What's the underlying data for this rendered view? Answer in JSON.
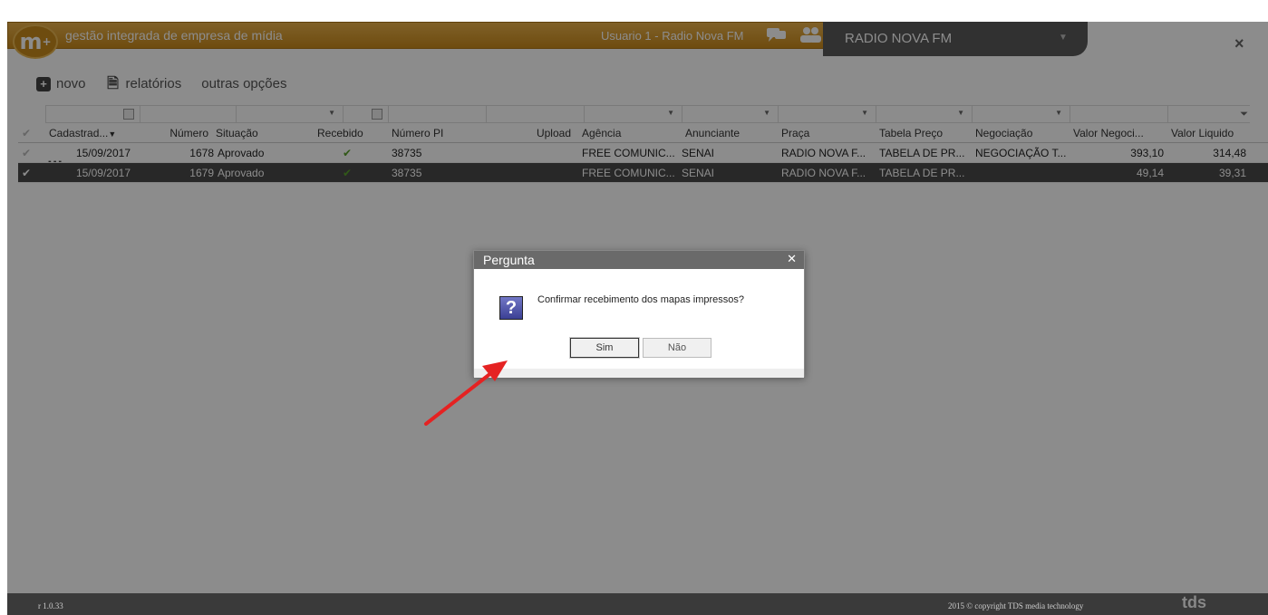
{
  "titlebar": {
    "app_title": "gestão integrada de empresa de mídia",
    "user_label": "Usuario 1 - Radio Nova FM",
    "station": "RADIO NOVA FM",
    "logo_text": "m",
    "logo_sub": "+"
  },
  "toolbar": {
    "novo": "novo",
    "relatorios": "relatórios",
    "outras": "outras opções"
  },
  "columns": [
    "Cadastrad...",
    "Número",
    "Situação",
    "Recebido",
    "Número PI",
    "Upload",
    "Agência",
    "Anunciante",
    "Praça",
    "Tabela Preço",
    "Negociação",
    "Valor Negoci...",
    "Valor Liquido"
  ],
  "rows": [
    {
      "cadastro": "15/09/2017",
      "numero": "1678",
      "situacao": "Aprovado",
      "recebido": "✔",
      "numero_pi": "38735",
      "upload": "",
      "agencia": "FREE COMUNIC...",
      "anunciante": "SENAI",
      "praca": "RADIO NOVA F...",
      "tabela": "TABELA DE PR...",
      "negociacao": "NEGOCIAÇÃO T...",
      "valor_neg": "393,10",
      "valor_liq": "314,48"
    },
    {
      "cadastro": "15/09/2017",
      "numero": "1679",
      "situacao": "Aprovado",
      "recebido": "✔",
      "numero_pi": "38735",
      "upload": "",
      "agencia": "FREE COMUNIC...",
      "anunciante": "SENAI",
      "praca": "RADIO NOVA F...",
      "tabela": "TABELA DE PR...",
      "negociacao": "",
      "valor_neg": "49,14",
      "valor_liq": "39,31"
    }
  ],
  "dialog": {
    "title": "Pergunta",
    "message": "Confirmar recebimento dos mapas impressos?",
    "yes": "Sim",
    "no": "Não"
  },
  "footer": {
    "version": "r 1.0.33",
    "copyright": "2015 © copyright TDS media technology",
    "brand": "tds"
  }
}
